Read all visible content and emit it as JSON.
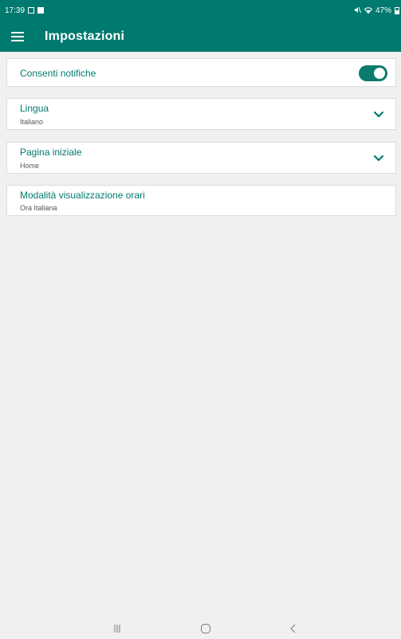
{
  "status_bar": {
    "time": "17:39",
    "battery": "47%",
    "battery_level": 0.47,
    "icons": [
      "gallery-icon",
      "download-icon",
      "mute-icon",
      "wifi-icon",
      "battery-icon"
    ]
  },
  "app_bar": {
    "title": "Impostazioni",
    "menu_icon": "hamburger-menu-icon"
  },
  "settings": {
    "notifications": {
      "label": "Consenti notifiche",
      "enabled": true
    },
    "language": {
      "label": "Lingua",
      "value": "Italiano"
    },
    "home_page": {
      "label": "Pagina iniziale",
      "value": "Home"
    },
    "time_display": {
      "label": "Modalità visualizzazione orari",
      "value": "Ora Italiana"
    }
  },
  "navigation_bar": {
    "icons": [
      "recent-apps-icon",
      "home-icon",
      "back-icon"
    ]
  },
  "colors": {
    "primary": "#007a6e",
    "accent_text": "#007a6e",
    "background": "#f0f0f0",
    "card": "#ffffff"
  }
}
